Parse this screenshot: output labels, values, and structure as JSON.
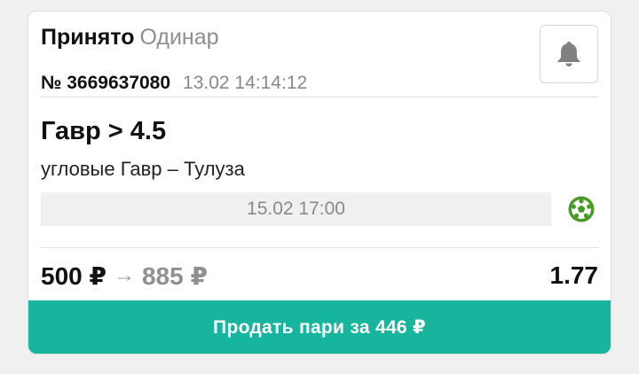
{
  "bet": {
    "status": "Принято",
    "type": "Одинар",
    "number": "№ 3669637080",
    "date": "13.02 14:14:12"
  },
  "selection": {
    "title": "Гавр > 4.5",
    "event": "угловые Гавр – Тулуза",
    "start_time": "15.02 17:00"
  },
  "amounts": {
    "stake": "500 ₽",
    "arrow": "→",
    "payout": "885 ₽",
    "odds": "1.77"
  },
  "sell_button": {
    "label": "Продать пари за 446 ₽"
  },
  "icons": {
    "notify": "bell-icon",
    "sport": "football-icon"
  },
  "colors": {
    "accent": "#17b59e",
    "sport_icon": "#4a9a2a",
    "muted_text": "#8e8e8e"
  }
}
